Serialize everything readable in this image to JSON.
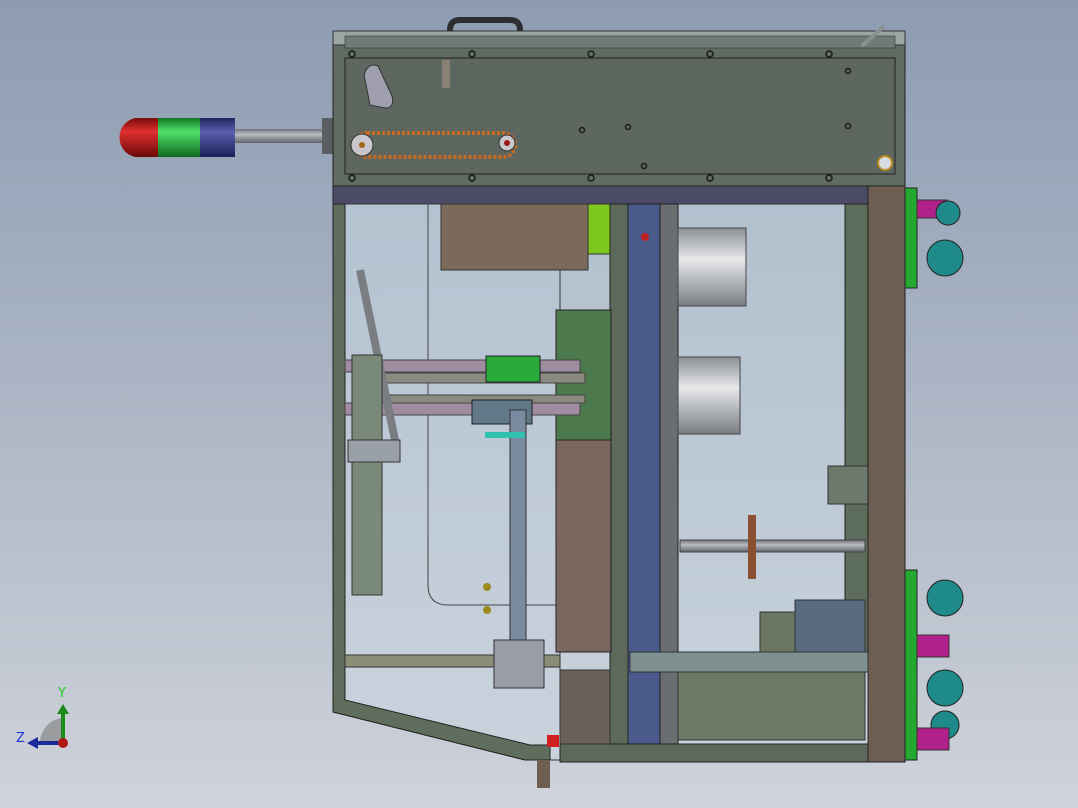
{
  "view": {
    "type": "cad-model-viewport",
    "colors": {
      "frame": "#5d6a5b",
      "panel": "#5f6a62",
      "band": "#4b4b68",
      "post": "#6e5d51",
      "glass": "#c6d6de",
      "lamp_red": "#b01818",
      "lamp_green": "#22b83a",
      "lamp_blue": "#3a3f88",
      "caster_teal": "#1f8a8a",
      "caster_magenta": "#b0208a"
    }
  },
  "triad": {
    "y_label": "Y",
    "z_label": "Z"
  }
}
